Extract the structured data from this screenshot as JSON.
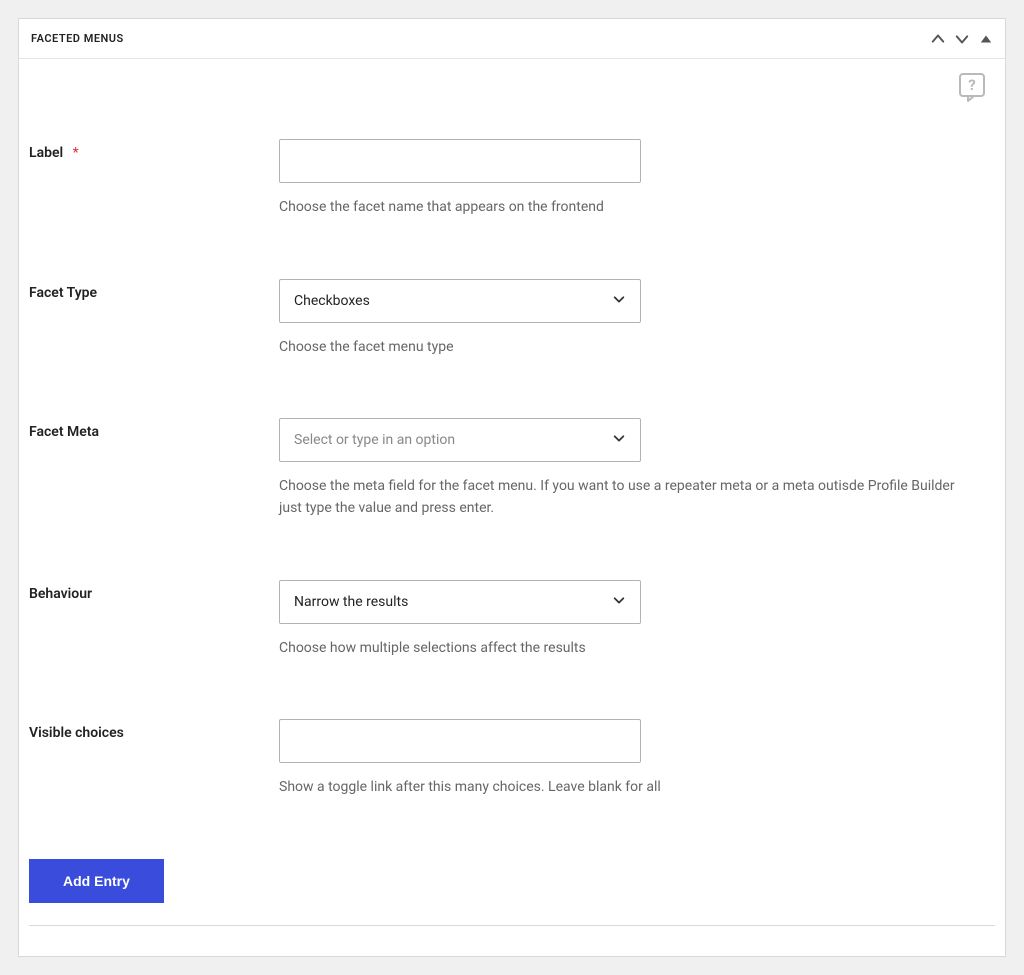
{
  "header": {
    "title": "FACETED MENUS"
  },
  "fields": {
    "label": {
      "label": "Label",
      "required_mark": "*",
      "value": "",
      "help": "Choose the facet name that appears on the frontend"
    },
    "facet_type": {
      "label": "Facet Type",
      "value": "Checkboxes",
      "help": "Choose the facet menu type"
    },
    "facet_meta": {
      "label": "Facet Meta",
      "placeholder": "Select or type in an option",
      "help": "Choose the meta field for the facet menu. If you want to use a repeater meta or a meta outisde Profile Builder just type the value and press enter."
    },
    "behaviour": {
      "label": "Behaviour",
      "value": "Narrow the results",
      "help": "Choose how multiple selections affect the results"
    },
    "visible_choices": {
      "label": "Visible choices",
      "value": "",
      "help": "Show a toggle link after this many choices. Leave blank for all"
    }
  },
  "buttons": {
    "add_entry": "Add Entry"
  }
}
